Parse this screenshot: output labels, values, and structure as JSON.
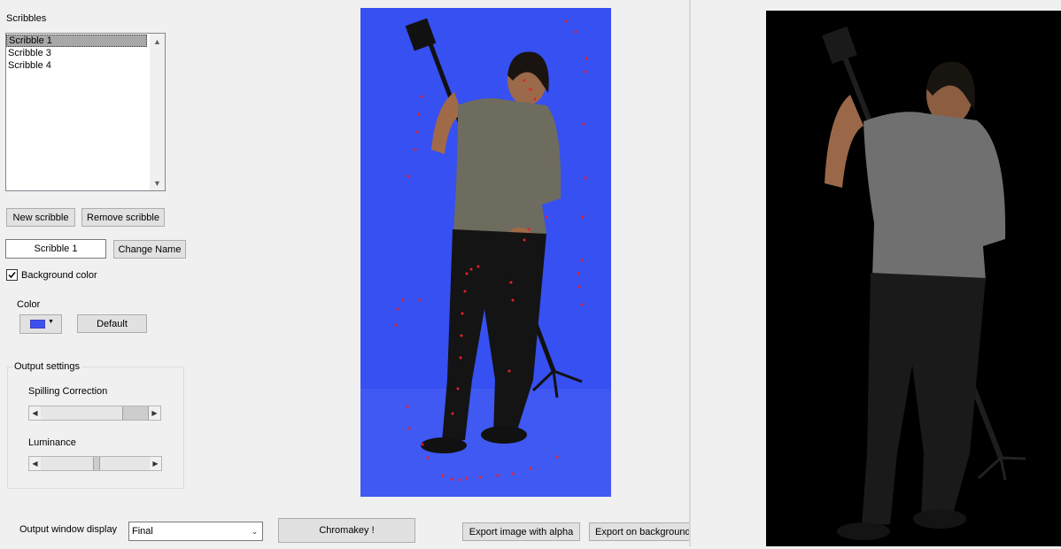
{
  "scribbles": {
    "label": "Scribbles",
    "items": [
      {
        "label": "Scribble 1",
        "selected": true
      },
      {
        "label": "Scribble 3",
        "selected": false
      },
      {
        "label": "Scribble 4",
        "selected": false
      }
    ]
  },
  "buttons": {
    "new_scribble": "New scribble",
    "remove_scribble": "Remove scribble",
    "change_name": "Change Name",
    "default": "Default",
    "chromakey": "Chromakey !",
    "export_alpha": "Export image with alpha",
    "export_background": "Export on background"
  },
  "name_field": {
    "value": "Scribble 1"
  },
  "background_color": {
    "label": "Background color",
    "checked": true
  },
  "color": {
    "label": "Color",
    "swatch": "#3c50f0"
  },
  "output_settings": {
    "title": "Output settings",
    "spilling": {
      "label": "Spilling Correction",
      "level_pct": 75
    },
    "luminance": {
      "label": "Luminance",
      "level_pct": 55
    }
  },
  "output_display": {
    "label": "Output window display",
    "value": "Final"
  },
  "colors": {
    "source_bg": "#3650f2",
    "output_bg": "#000000",
    "scribble_dot": "#e8202a"
  }
}
